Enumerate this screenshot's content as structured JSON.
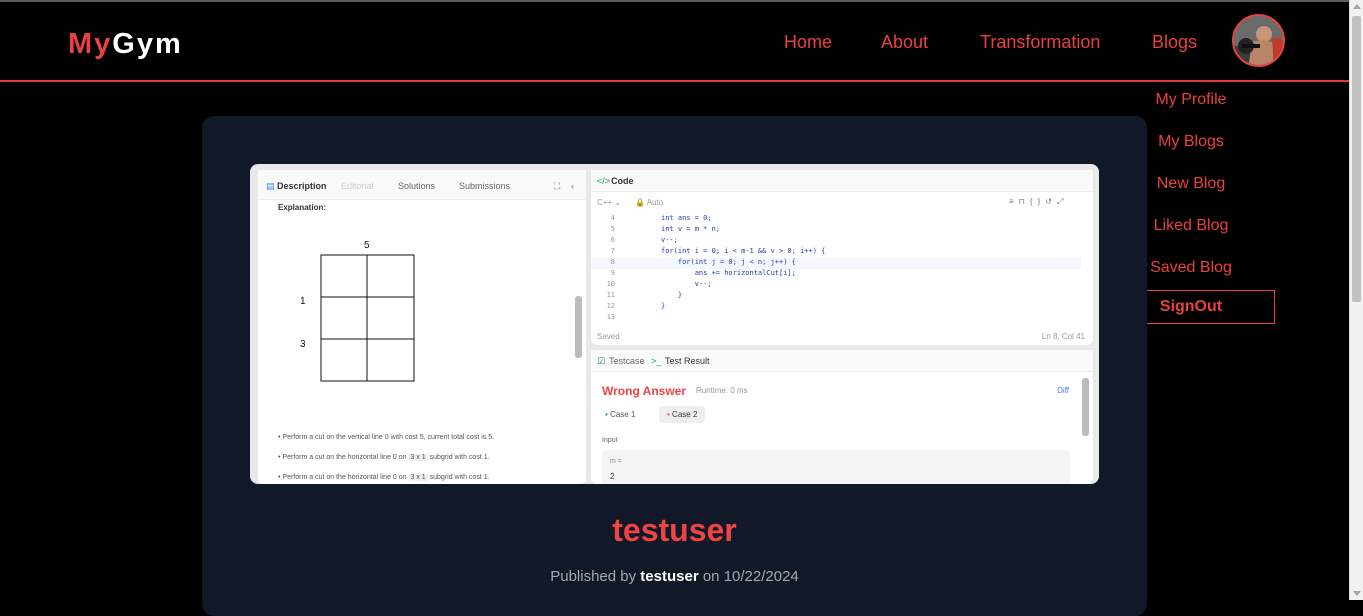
{
  "logo": {
    "part1": "My",
    "part2": "Gym"
  },
  "nav": {
    "home": "Home",
    "about": "About",
    "transformation": "Transformation",
    "blogs": "Blogs"
  },
  "dropdown": {
    "my_profile": "My Profile",
    "my_blogs": "My Blogs",
    "new_blog": "New Blog",
    "liked_blog": "Liked Blog",
    "saved_blog": "Saved Blog",
    "signout": "SignOut"
  },
  "post": {
    "title": "testuser",
    "published_by_prefix": "Published by",
    "author": "testuser",
    "date_prefix": "on",
    "date": "10/22/2024"
  },
  "screenshot": {
    "left_tabs": [
      "Description",
      "Editorial",
      "Solutions",
      "Submissions"
    ],
    "explanation_label": "Explanation:",
    "grid_top_label": "5",
    "grid_left_labels": [
      "1",
      "3"
    ],
    "bullets": [
      "Perform a cut on the vertical line 0 with cost 5, current total cost is 5.",
      "Perform a cut on the horizontal line 0 on",
      "Perform a cut on the horizontal line 0 on"
    ],
    "bullet_suffixes": [
      "",
      "subgrid with cost 1.",
      "subgrid with cost 1."
    ],
    "chip": "3 x 1",
    "code_tab": "Code",
    "lang": "C++",
    "auto": "Auto",
    "code_lines": [
      {
        "n": "4",
        "t": "int ans = 0;"
      },
      {
        "n": "5",
        "t": "int v = m * n;"
      },
      {
        "n": "6",
        "t": "v--;"
      },
      {
        "n": "7",
        "t": "for(int i = 0; i < m-1 && v > 0; i++) {"
      },
      {
        "n": "8",
        "t": "    for(int j = 0; j < n; j++) {"
      },
      {
        "n": "9",
        "t": "        ans += horizontalCut[i];"
      },
      {
        "n": "10",
        "t": "        v--;"
      },
      {
        "n": "11",
        "t": "    }"
      },
      {
        "n": "12",
        "t": "}"
      },
      {
        "n": "13",
        "t": ""
      }
    ],
    "saved": "Saved",
    "cursor_pos": "Ln 8, Col 41",
    "testcase_tab": "Testcase",
    "test_result_tab": "Test Result",
    "wrong_answer": "Wrong Answer",
    "runtime": "Runtime: 0 ms",
    "diff": "Diff",
    "case1": "Case 1",
    "case2": "Case 2",
    "input_label": "Input",
    "var_m": "m =",
    "val_m": "2"
  }
}
